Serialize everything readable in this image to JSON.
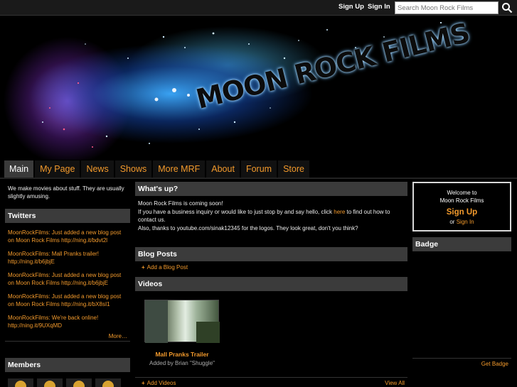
{
  "topbar": {
    "signup": "Sign Up",
    "signin": "Sign In",
    "search_placeholder": "Search Moon Rock Films"
  },
  "banner": {
    "logo_text": "MOON ROCK FILMS"
  },
  "nav": {
    "tabs": [
      "Main",
      "My Page",
      "News",
      "Shows",
      "More MRF",
      "About",
      "Forum",
      "Store"
    ],
    "active": "Main"
  },
  "left": {
    "about": "We make movies about stuff. They are usually slightly amusing.",
    "twitters_title": "Twitters",
    "twitters": [
      "MoonRockFilms: Just added a new blog post on Moon Rock Films http://ning.it/bdvt2l",
      "MoonRockFilms: Mall Pranks trailer! http://ning.it/b6jbjE",
      "MoonRockFilms: Just added a new blog post on Moon Rock Films http://ning.it/b6jbjE",
      "MoonRockFilms: Just added a new blog post on Moon Rock Films http://ning.it/bX8sI1",
      "MoonRockFilms: We're back online! http://ning.it/9UXqMD"
    ],
    "more": "More…",
    "members_title": "Members"
  },
  "mid": {
    "whatsup_title": "What's up?",
    "whatsup_l1": "Moon Rock Films is coming soon!",
    "whatsup_l2a": "If you have a business inquiry or would like to just stop by and say hello, click ",
    "whatsup_here": "here",
    "whatsup_l2b": " to find out how to contact us.",
    "whatsup_l3": "Also, thanks to youtube.com/sinak12345 for the logos. They look great, don't you think?",
    "blog_title": "Blog Posts",
    "add_blog": "Add a Blog Post",
    "videos_title": "Videos",
    "video_title": "Mall Pranks Trailer",
    "video_by": "Added by Brian \"Shuggle\"",
    "add_videos": "Add Videos",
    "view_all": "View All"
  },
  "right": {
    "welcome_l1": "Welcome to",
    "welcome_l2": "Moon Rock Films",
    "signup": "Sign Up",
    "or": "or",
    "signin": "Sign In",
    "badge_title": "Badge",
    "get_badge": "Get Badge"
  },
  "colors": {
    "accent": "#f39a2c",
    "header_bg": "#3b3b3b",
    "page_bg": "#000000"
  }
}
